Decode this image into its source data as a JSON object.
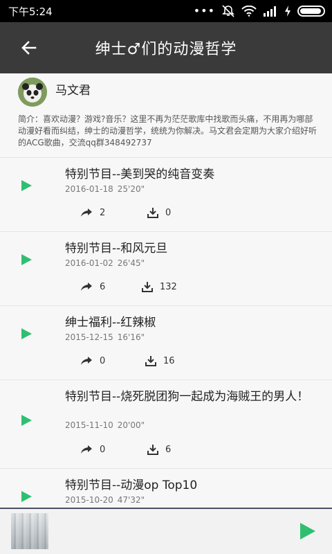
{
  "status_bar": {
    "time": "下午5:24"
  },
  "toolbar": {
    "title": "绅士♂们的动漫哲学"
  },
  "author": {
    "name": "马文君",
    "intro": "简介：喜欢动漫？游戏?音乐？这里不再为茫茫歌库中找歌而头痛，不用再为哪部动漫好看而纠结，绅士的动漫哲学，统统为你解决。马文君会定期为大家介绍好听的ACG歌曲，交流qq群348492737"
  },
  "episodes": [
    {
      "title": "特别节目--美到哭的纯音变奏",
      "date": "2016-01-18",
      "duration": "25'20\"",
      "shares": "2",
      "downloads": "0"
    },
    {
      "title": "特别节目--和风元旦",
      "date": "2016-01-02",
      "duration": "26'45\"",
      "shares": "6",
      "downloads": "132"
    },
    {
      "title": "绅士福利--红辣椒",
      "date": "2015-12-15",
      "duration": "16'16\"",
      "shares": "0",
      "downloads": "16"
    },
    {
      "title": "特别节目--烧死脱团狗一起成为海贼王的男人！",
      "date": "2015-11-10",
      "duration": "20'00\"",
      "shares": "0",
      "downloads": "6"
    },
    {
      "title": "特别节目--动漫op Top10",
      "date": "2015-10-20",
      "duration": "47'32\"",
      "shares": "",
      "downloads": ""
    }
  ],
  "colors": {
    "toolbar": "#3a3a3a",
    "accent_play": "#2fbf71",
    "player_border": "#4a4f63"
  },
  "icons": {
    "back": "arrow-left-icon",
    "play": "play-icon",
    "share": "share-arrow-icon",
    "download": "download-icon"
  }
}
